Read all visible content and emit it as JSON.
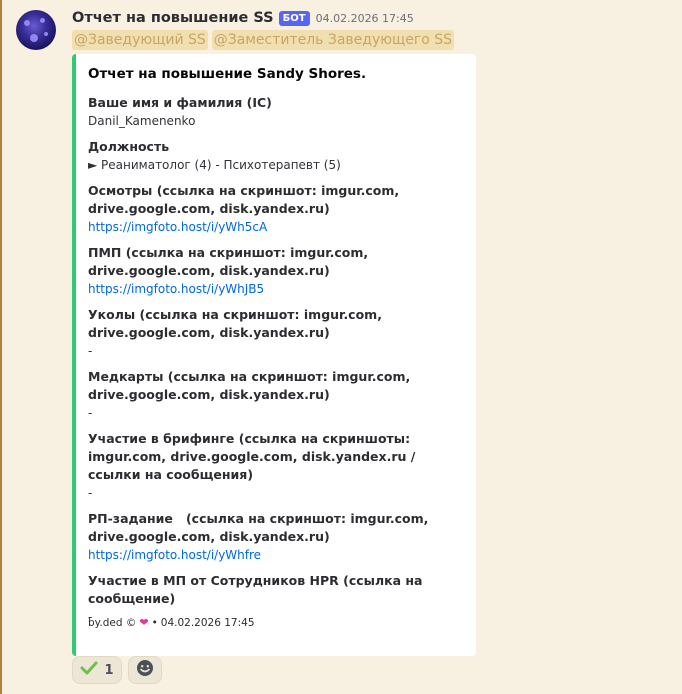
{
  "message": {
    "username": "Отчет на повышение SS",
    "bot_tag": "БОТ",
    "timestamp": "04.02.2026 17:45",
    "mentions": [
      "@Заведующий SS",
      "@Заместитель Заведующего SS"
    ]
  },
  "embed": {
    "accent_color": "#2ecc71",
    "title": "Отчет на повышение Sandy Shores.",
    "fields": [
      {
        "name": "Ваше имя и фамилия (IC)",
        "value": "Danil_Kamenenko",
        "is_link": false
      },
      {
        "name": "Должность",
        "value": "► Реаниматолог (4) - Психотерапевт (5)",
        "is_link": false
      },
      {
        "name": "Осмотры (ссылка на скриншот: imgur.com, drive.google.com, disk.yandex.ru)",
        "value": "https://imgfoto.host/i/yWh5cA",
        "is_link": true
      },
      {
        "name": "ПМП (ссылка на скриншот: imgur.com, drive.google.com, disk.yandex.ru)",
        "value": "https://imgfoto.host/i/yWhJB5",
        "is_link": true
      },
      {
        "name": "Уколы (ссылка на скриншот: imgur.com, drive.google.com, disk.yandex.ru)",
        "value": "-",
        "is_link": false
      },
      {
        "name": "Медкарты (ссылка на скриншот: imgur.com, drive.google.com, disk.yandex.ru)",
        "value": "-",
        "is_link": false
      },
      {
        "name": "Участие в брифинге (ссылка на скриншоты: imgur.com, drive.google.com, disk.yandex.ru /ссылки на сообщения)",
        "value": "-",
        "is_link": false
      },
      {
        "name": "РП-задание   (ссылка на скриншот: imgur.com, drive.google.com, disk.yandex.ru)",
        "value": "https://imgfoto.host/i/yWhfre",
        "is_link": true
      },
      {
        "name": "Участие в МП от Сотрудников HPR (ссылка на сообщение)",
        "value": "-",
        "is_link": false
      }
    ],
    "footer": {
      "text": "by.ded ©",
      "separator": "•",
      "timestamp": "04.02.2026 17:45"
    }
  },
  "reactions": [
    {
      "icon": "check-mark-icon",
      "count": "1"
    },
    {
      "icon": "add-reaction-icon"
    }
  ]
}
